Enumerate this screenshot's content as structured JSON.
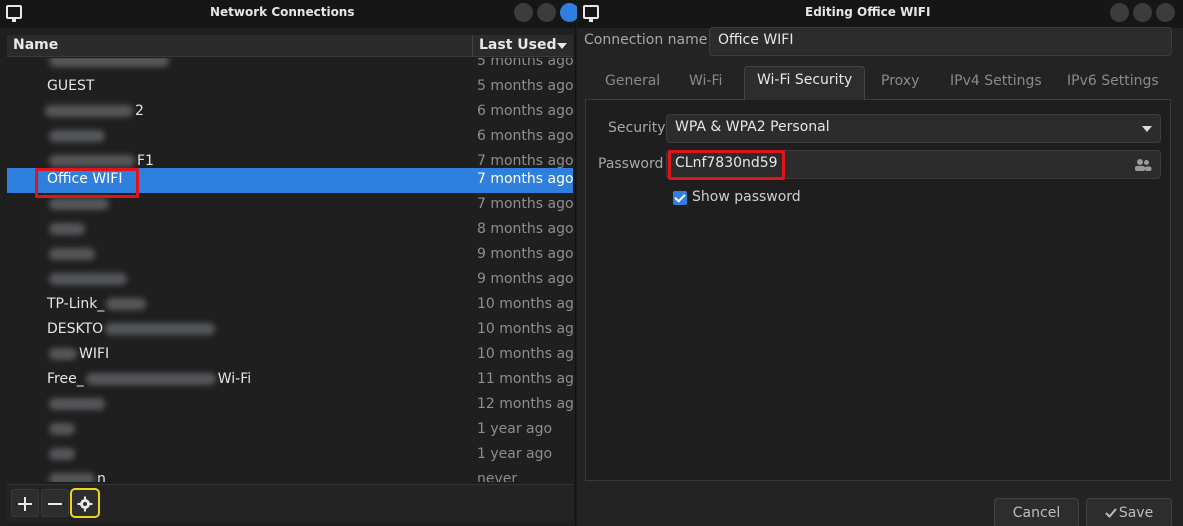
{
  "left_window": {
    "title": "Network Connections",
    "columns": {
      "name": "Name",
      "last_used": "Last Used"
    },
    "rows": [
      {
        "name": "",
        "last_used": "5 months ago"
      },
      {
        "name": "GUEST",
        "last_used": "5 months ago"
      },
      {
        "name": "2",
        "last_used": "6 months ago"
      },
      {
        "name": "",
        "last_used": "6 months ago"
      },
      {
        "name": "F1",
        "last_used": "7 months ago"
      },
      {
        "name": "Office WIFI",
        "last_used": "7 months ago"
      },
      {
        "name": "",
        "last_used": "7 months ago"
      },
      {
        "name": "",
        "last_used": "8 months ago"
      },
      {
        "name": "",
        "last_used": "9 months ago"
      },
      {
        "name": "",
        "last_used": "9 months ago"
      },
      {
        "name": "TP-Link_",
        "last_used": "10 months ago"
      },
      {
        "name": "DESKTO",
        "last_used": "10 months ago"
      },
      {
        "name": "WIFI",
        "last_used": "10 months ago"
      },
      {
        "name": "Free_",
        "name_suffix": "Wi-Fi",
        "last_used": "11 months ago"
      },
      {
        "name": "",
        "last_used": "12 months ago"
      },
      {
        "name": "",
        "last_used": "1 year ago"
      },
      {
        "name": "",
        "last_used": "1 year ago"
      },
      {
        "name": "n",
        "last_used": "never"
      }
    ],
    "toolbar": {
      "add_icon": "plus-icon",
      "remove_icon": "minus-icon",
      "settings_icon": "gear-icon"
    }
  },
  "right_window": {
    "title": "Editing Office WIFI",
    "connection_name_label": "Connection name",
    "connection_name_value": "Office WIFI",
    "tabs": [
      "General",
      "Wi-Fi",
      "Wi-Fi Security",
      "Proxy",
      "IPv4 Settings",
      "IPv6 Settings"
    ],
    "active_tab": "Wi-Fi Security",
    "security_label": "Security",
    "security_value": "WPA & WPA2 Personal",
    "password_label": "Password",
    "password_value": "CLnf7830nd59",
    "show_password_label": "Show password",
    "show_password_checked": true,
    "cancel_label": "Cancel",
    "save_label": "Save"
  },
  "colors": {
    "selection": "#2f7fde",
    "highlight_red": "#e0151b",
    "highlight_yellow": "#ecd51b",
    "background": "#1f1f1f"
  }
}
